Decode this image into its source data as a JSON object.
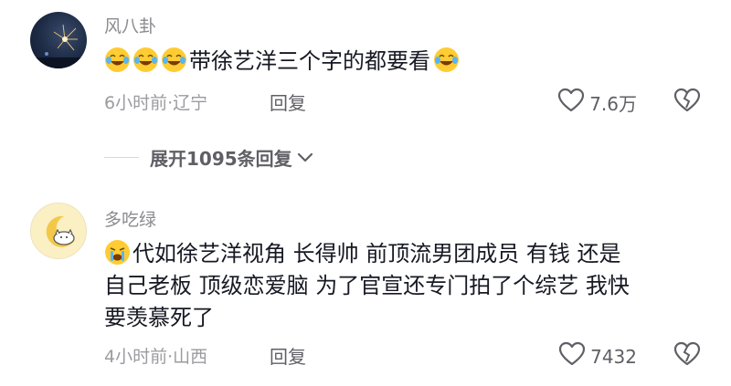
{
  "comments": [
    {
      "username": "风八卦",
      "text": "带徐艺洋三个字的都要看",
      "time_location": "6小时前·辽宁",
      "reply_label": "回复",
      "likes": "7.6万"
    },
    {
      "username": "多吃绿",
      "text": "代如徐艺洋视角 长得帅 前顶流男团成员 有钱 还是\n自己老板 顶级恋爱脑 为了官宣还专门拍了个综艺 我快\n要羡慕死了",
      "time_location": "4小时前·山西",
      "reply_label": "回复",
      "likes": "7432"
    }
  ],
  "expand_replies": "展开1095条回复",
  "icons": {
    "laugh_cry": "laugh-cry-emoji",
    "crying": "loudly-crying-emoji",
    "heart": "heart-outline-icon",
    "dislike": "broken-heart-icon",
    "chevron": "chevron-down-icon"
  },
  "colors": {
    "text": "#161823",
    "meta": "#9b9ba0",
    "username": "#8b8b90"
  }
}
